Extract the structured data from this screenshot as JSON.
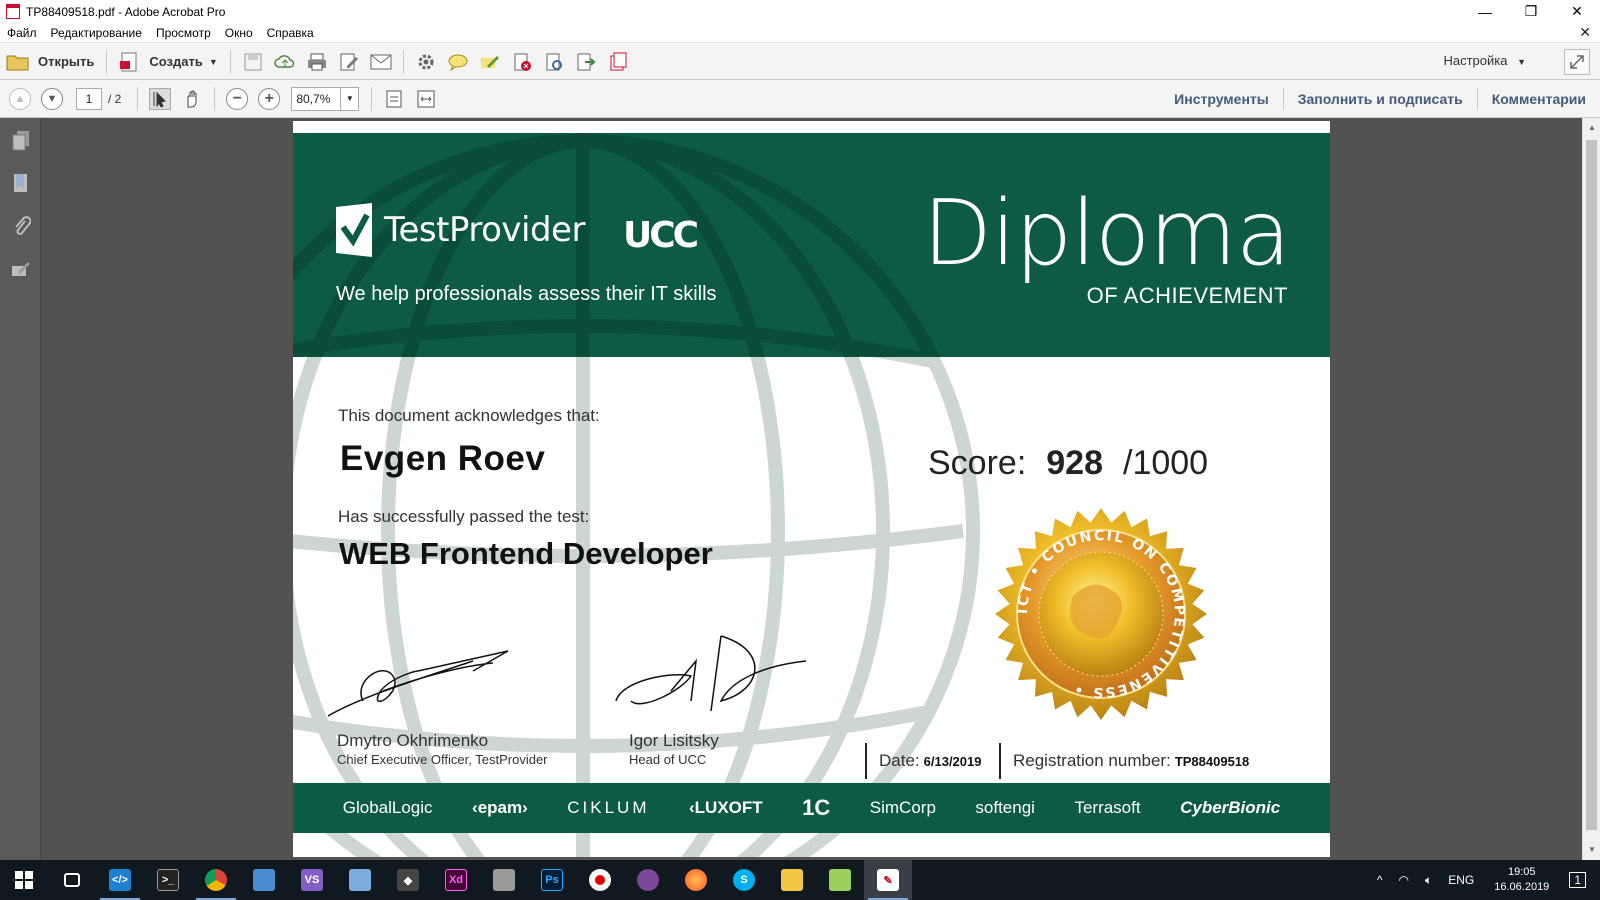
{
  "window": {
    "title": "TP88409518.pdf - Adobe Acrobat Pro",
    "minimize": "—",
    "restore": "❐",
    "close": "✕"
  },
  "menu": [
    "Файл",
    "Редактирование",
    "Просмотр",
    "Окно",
    "Справка"
  ],
  "menu_close": "✕",
  "toolbar": {
    "open_label": "Открыть",
    "create_label": "Создать",
    "settings_label": "Настройка"
  },
  "navbar": {
    "current_page": "1",
    "total_pages": "/ 2",
    "zoom": "80,7%",
    "panes": [
      "Инструменты",
      "Заполнить и подписать",
      "Комментарии"
    ]
  },
  "certificate": {
    "brand": "TestProvider",
    "partner_logo": "UCC",
    "tagline": "We help professionals assess their IT skills",
    "title": "Diploma",
    "subtitle": "OF ACHIEVEMENT",
    "ack_text": "This document acknowledges that:",
    "recipient": "Evgen Roev",
    "passed_text": "Has successfully passed the test:",
    "test_name": "WEB Frontend Developer",
    "score_label": "Score:",
    "score_value": "928",
    "score_max": "/1000",
    "seal_text": "ICT • COUNCIL ON COMPETITIVENESS •",
    "signer1_name": "Dmytro Okhrimenko",
    "signer1_role": "Chief Executive Officer, TestProvider",
    "signer2_name": "Igor Lisitsky",
    "signer2_role": "Head of UCC",
    "date_label": "Date:",
    "date_value": "6/13/2019",
    "reg_label": "Registration number:",
    "reg_value": "TP88409518",
    "partners": [
      "GlobalLogic",
      "‹epam›",
      "CIKLUM",
      "‹LUXOFT",
      "1С",
      "SimCorp",
      "softengi",
      "Terrasoft",
      "CyberBionic"
    ]
  },
  "taskbar": {
    "apps": [
      "windows",
      "task-view",
      "vscode",
      "terminal",
      "chrome",
      "app-blue",
      "visual-studio",
      "notepad",
      "inkscape",
      "adobe-xd",
      "app-gray",
      "photoshop",
      "recorder",
      "tor",
      "firefox",
      "skype",
      "explorer",
      "notepad-green",
      "acrobat"
    ],
    "tray_lang": "ENG",
    "time": "19:05",
    "date": "16.06.2019",
    "notifications": "1"
  },
  "colors": {
    "cert_green": "#0d5a45",
    "pane_link": "#455b79",
    "taskbar": "#101820"
  }
}
